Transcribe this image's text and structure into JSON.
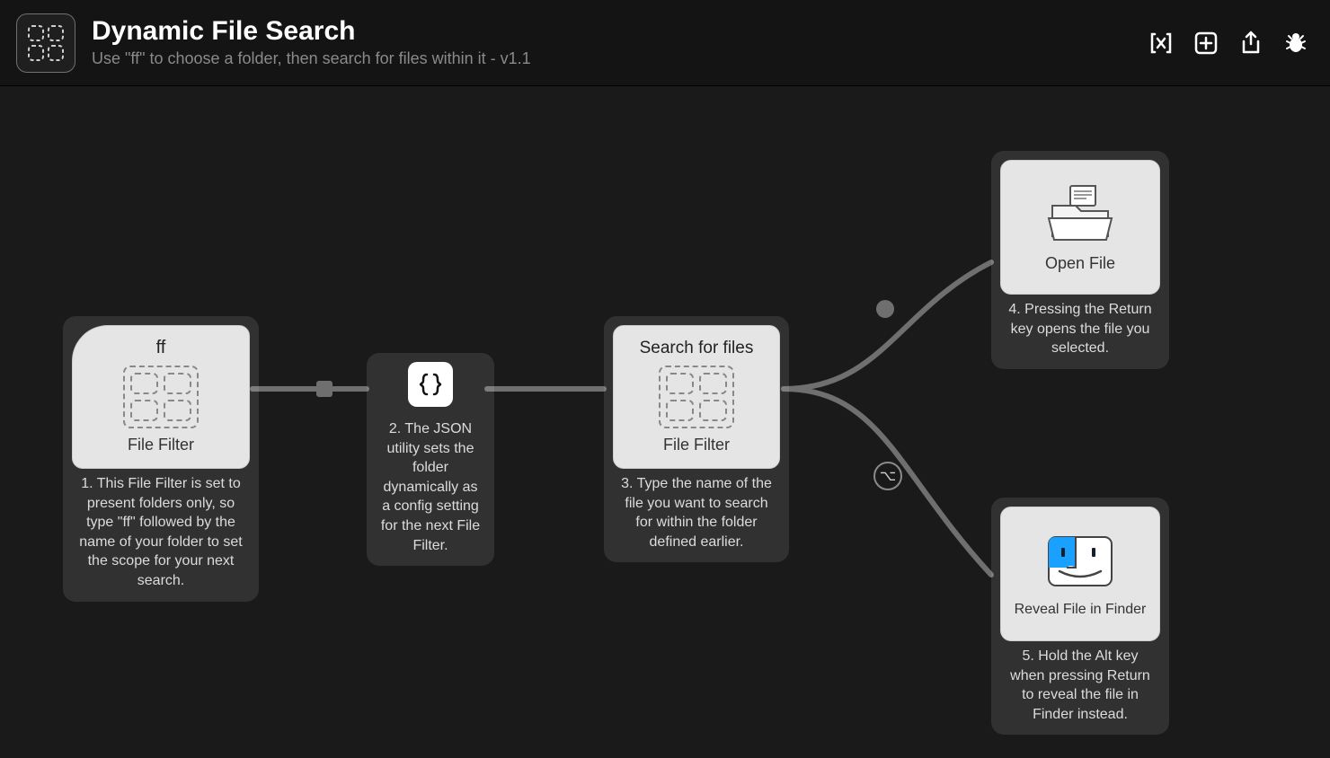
{
  "header": {
    "title": "Dynamic File Search",
    "subtitle": "Use \"ff\" to choose a folder, then search for files within it - v1.1"
  },
  "toolbar": {
    "vars_tooltip": "Workflow Environment Variables",
    "add_tooltip": "Add object",
    "share_tooltip": "Export / Share",
    "debug_tooltip": "Debug"
  },
  "nodes": {
    "ff": {
      "keyword": "ff",
      "label": "File Filter",
      "desc": "1. This File Filter is set to present folders only, so type \"ff\" followed by the name of your folder to set the scope for your next search."
    },
    "json": {
      "desc": "2. The JSON utility sets the folder dynamically as a config setting for the next File Filter."
    },
    "search": {
      "title": "Search for files",
      "label": "File Filter",
      "desc": "3. Type the name of the file you want to search for within the folder defined earlier."
    },
    "open": {
      "label": "Open File",
      "desc": "4. Pressing the Return key opens the file you selected."
    },
    "reveal": {
      "label": "Reveal File in Finder",
      "desc": "5. Hold the Alt key when pressing Return to reveal the file in Finder instead."
    }
  },
  "modifier": {
    "symbol": "⌥"
  }
}
